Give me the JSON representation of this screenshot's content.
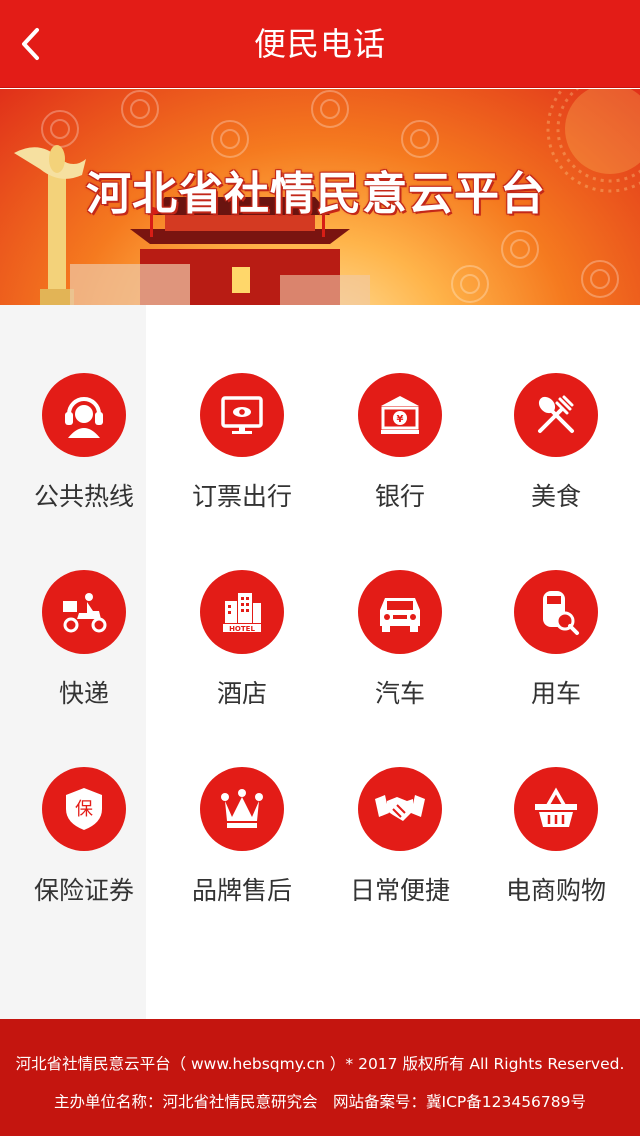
{
  "header": {
    "title": "便民电话",
    "back_icon": "chevron-left-icon"
  },
  "banner": {
    "title": "河北省社情民意云平台"
  },
  "colors": {
    "primary": "#e31c17",
    "footer": "#c4150f",
    "sidebar": "#f5f5f5"
  },
  "categories": [
    {
      "label": "公共热线",
      "icon": "headset-icon"
    },
    {
      "label": "订票出行",
      "icon": "monitor-eye-icon"
    },
    {
      "label": "银行",
      "icon": "bank-icon"
    },
    {
      "label": "美食",
      "icon": "spoon-fork-icon"
    },
    {
      "label": "快递",
      "icon": "delivery-scooter-icon"
    },
    {
      "label": "酒店",
      "icon": "hotel-icon"
    },
    {
      "label": "汽车",
      "icon": "car-icon"
    },
    {
      "label": "用车",
      "icon": "car-search-icon"
    },
    {
      "label": "保险证券",
      "icon": "insurance-shield-icon"
    },
    {
      "label": "品牌售后",
      "icon": "crown-icon"
    },
    {
      "label": "日常便捷",
      "icon": "handshake-icon"
    },
    {
      "label": "电商购物",
      "icon": "shopping-basket-icon"
    }
  ],
  "footer": {
    "line1": "河北省社情民意云平台（ www.hebsqmy.cn ）* 2017 版权所有 All Rights Reserved.",
    "line2": "主办单位名称：河北省社情民意研究会　网站备案号：冀ICP备123456789号"
  }
}
